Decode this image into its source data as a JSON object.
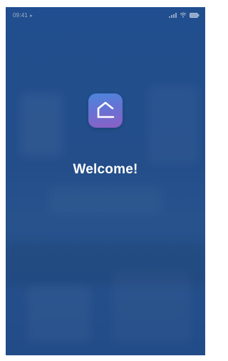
{
  "status_bar": {
    "time": "09:41",
    "location_icon": "location-arrow-icon",
    "signal_icon": "cellular-signal-icon",
    "wifi_icon": "wifi-icon",
    "battery_icon": "battery-icon"
  },
  "splash": {
    "app_icon": "home-icon",
    "welcome_text": "Welcome!"
  },
  "colors": {
    "background": "#234e8a",
    "icon_gradient_start": "#4b86dd",
    "icon_gradient_end": "#8d5fc4",
    "text": "#ffffff"
  }
}
